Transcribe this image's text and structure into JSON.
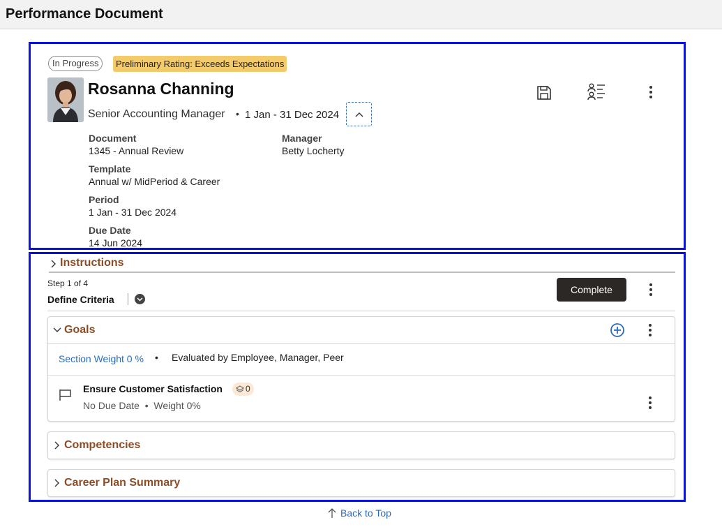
{
  "page": {
    "title": "Performance Document"
  },
  "header": {
    "status": "In Progress",
    "rating": "Preliminary Rating: Exceeds Expectations",
    "employee": {
      "name": "Rosanna Channing",
      "job_title": "Senior Accounting Manager",
      "period": "1 Jan - 31 Dec 2024"
    },
    "fields": {
      "document_label": "Document",
      "document_value": "1345 - Annual Review",
      "manager_label": "Manager",
      "manager_value": "Betty Locherty",
      "template_label": "Template",
      "template_value": "Annual w/ MidPeriod & Career",
      "period_label": "Period",
      "period_value": "1 Jan - 31 Dec 2024",
      "due_label": "Due Date",
      "due_value": "14 Jun 2024"
    },
    "icons": [
      "save-icon",
      "people-list-icon",
      "more-actions-icon"
    ]
  },
  "body": {
    "instructions_label": "Instructions",
    "step": {
      "counter": "Step 1 of 4",
      "name": "Define Criteria"
    },
    "complete_label": "Complete",
    "goals": {
      "title": "Goals",
      "section_weight": "Section Weight 0 %",
      "evaluated_by": "Evaluated by Employee, Manager, Peer",
      "items": [
        {
          "name": "Ensure Customer Satisfaction",
          "badge_count": "0",
          "due": "No Due Date",
          "weight": "Weight 0%"
        }
      ]
    },
    "competencies_title": "Competencies",
    "career_title": "Career Plan Summary"
  },
  "footer": {
    "back_to_top": "Back to Top"
  },
  "colors": {
    "accent_border": "#0a12e0",
    "section_title": "#8b4c26",
    "link": "#2a6ebb",
    "rating_bg": "#f3cb6a",
    "button_dark": "#2b2825"
  }
}
